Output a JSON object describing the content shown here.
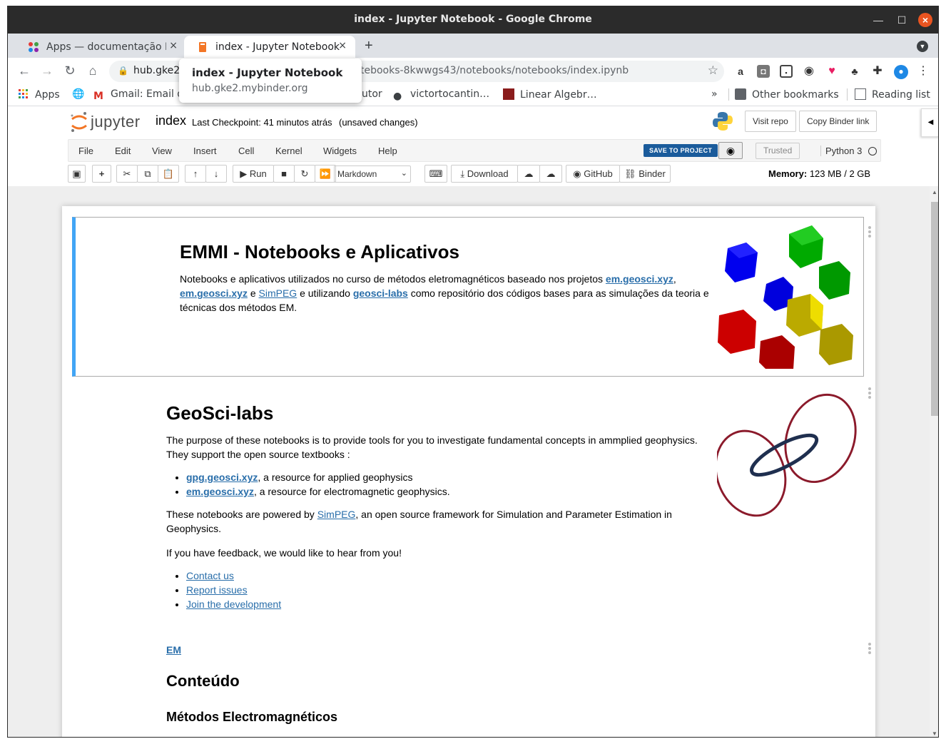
{
  "window": {
    "title": "index - Jupyter Notebook - Google Chrome"
  },
  "tabs": [
    {
      "label": "Apps — documentação M",
      "close": "×"
    },
    {
      "label": "index - Jupyter Notebook",
      "close": "×"
    }
  ],
  "tooltip": {
    "title": "index - Jupyter Notebook",
    "host": "hub.gke2.mybinder.org"
  },
  "address": {
    "host": "hub.gke2.r",
    "path": "tebooks-8kwwgs43/notebooks/notebooks/index.ipynb"
  },
  "bookmarks": {
    "apps": "Apps",
    "gmail": "Gmail: Email d",
    "tutor": "utor",
    "victor": "victortocantin…",
    "linear": "Linear Algebr…",
    "more": "»",
    "other": "Other bookmarks",
    "reading": "Reading list"
  },
  "jupyter": {
    "logo_text": "jupyter",
    "notebook_name": "index",
    "checkpoint": "Last Checkpoint: 41 minutos atrás",
    "status": "(unsaved changes)",
    "visit_repo": "Visit repo",
    "copy_binder": "Copy Binder link"
  },
  "menu": [
    "File",
    "Edit",
    "View",
    "Insert",
    "Cell",
    "Kernel",
    "Widgets",
    "Help"
  ],
  "save_project": "SAVE TO PROJECT",
  "trusted": "Trusted",
  "kernel": "Python 3",
  "toolbar": {
    "run": "Run",
    "cell_type": "Markdown",
    "download": "Download",
    "github": "GitHub",
    "binder": "Binder",
    "memory_label": "Memory:",
    "memory_value": "123 MB / 2 GB"
  },
  "cell1": {
    "title": "EMMI - Notebooks e Aplicativos",
    "p1": "Notebooks e aplicativos utilizados no curso de métodos eletromagnéticos baseado nos projetos ",
    "link1": "em.geosci.xyz",
    "comma": ",",
    "link2": "em.geosci.xyz",
    "e": " e ",
    "link3": "SimPEG",
    "p2": " e utilizando ",
    "link4": "geosci-labs",
    "p3": " como repositório dos códigos bases para as simulações da teoria e técnicas dos métodos EM."
  },
  "cell2": {
    "title": "GeoSci-labs",
    "p1": "The purpose of these notebooks is to provide tools for you to investigate fundamental concepts in ammplied geophysics. They support the open source textbooks :",
    "li1_link": "gpg.geosci.xyz",
    "li1_text": ", a resource for applied geophysics",
    "li2_link": "em.geosci.xyz",
    "li2_text": ", a resource for electromagnetic geophysics.",
    "p2a": "These notebooks are powered by ",
    "p2_link": "SimPEG",
    "p2b": ", an open source framework for Simulation and Parameter Estimation in Geophysics.",
    "p3": "If you have feedback, we would like to hear from you!",
    "links": [
      "Contact us",
      "Report issues",
      "Join the development"
    ]
  },
  "cell3": {
    "em_link": "EM",
    "h2": "Conteúdo",
    "h3": "Métodos Electromagnéticos"
  }
}
